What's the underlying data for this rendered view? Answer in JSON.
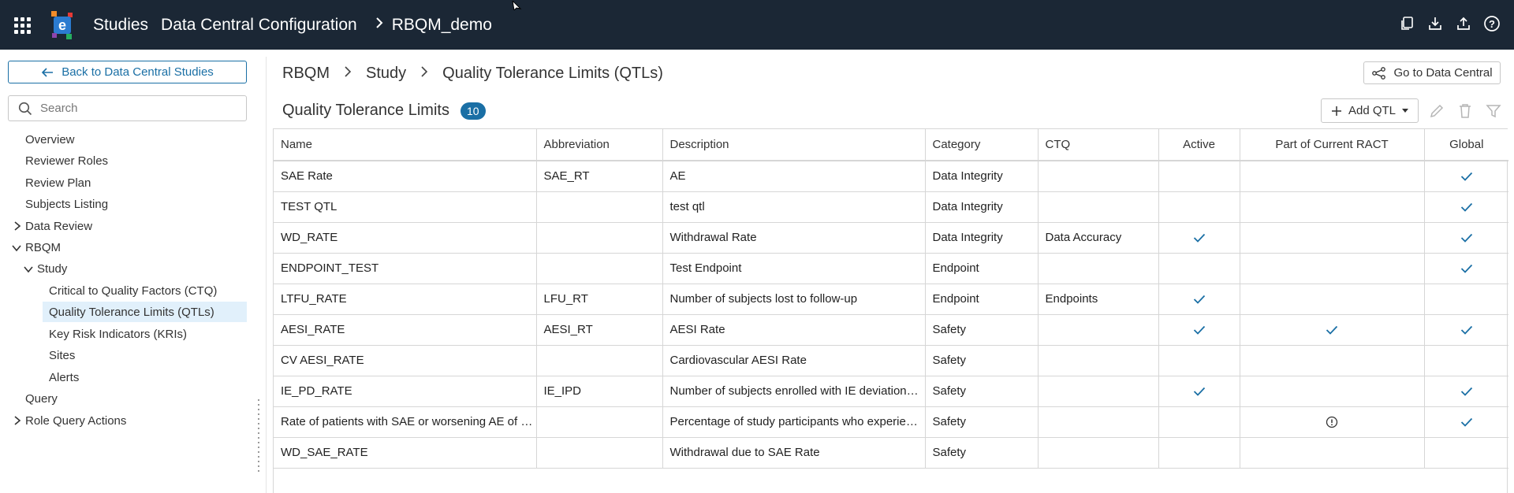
{
  "header": {
    "app_name": "Studies",
    "crumbs": [
      "Data Central Configuration",
      "RBQM_demo"
    ],
    "icons": [
      "copy-icon",
      "download-icon",
      "upload-icon",
      "help-icon"
    ]
  },
  "sidebar": {
    "back_label": "Back to Data Central Studies",
    "search_placeholder": "Search",
    "items": [
      {
        "label": "Overview"
      },
      {
        "label": "Reviewer Roles"
      },
      {
        "label": "Review Plan"
      },
      {
        "label": "Subjects Listing"
      },
      {
        "label": "Data Review"
      },
      {
        "label": "RBQM"
      },
      {
        "label": "Study"
      },
      {
        "label": "Critical to Quality Factors (CTQ)"
      },
      {
        "label": "Quality Tolerance Limits (QTLs)"
      },
      {
        "label": "Key Risk Indicators (KRIs)"
      },
      {
        "label": "Sites"
      },
      {
        "label": "Alerts"
      },
      {
        "label": "Query"
      },
      {
        "label": "Role Query Actions"
      }
    ]
  },
  "main": {
    "breadcrumb": [
      "RBQM",
      "Study",
      "Quality Tolerance Limits (QTLs)"
    ],
    "goto_label": "Go to Data Central",
    "title": "Quality Tolerance Limits",
    "count": "10",
    "add_label": "Add QTL",
    "accent_color": "#1a6fa5"
  },
  "table": {
    "columns": [
      "Name",
      "Abbreviation",
      "Description",
      "Category",
      "CTQ",
      "Active",
      "Part of Current RACT",
      "Global"
    ],
    "rows": [
      {
        "name": "SAE Rate",
        "abbr": "SAE_RT",
        "desc": "AE",
        "category": "Data Integrity",
        "ctq": "",
        "active": false,
        "ract": "",
        "global": true
      },
      {
        "name": "TEST QTL",
        "abbr": "",
        "desc": "test qtl",
        "category": "Data Integrity",
        "ctq": "",
        "active": false,
        "ract": "",
        "global": true
      },
      {
        "name": "WD_RATE",
        "abbr": "",
        "desc": "Withdrawal Rate",
        "category": "Data Integrity",
        "ctq": "Data Accuracy",
        "active": true,
        "ract": "",
        "global": true
      },
      {
        "name": "ENDPOINT_TEST",
        "abbr": "",
        "desc": "Test Endpoint",
        "category": "Endpoint",
        "ctq": "",
        "active": false,
        "ract": "",
        "global": true
      },
      {
        "name": "LTFU_RATE",
        "abbr": "LFU_RT",
        "desc": "Number of subjects lost to follow-up",
        "category": "Endpoint",
        "ctq": "Endpoints",
        "active": true,
        "ract": "",
        "global": false
      },
      {
        "name": "AESI_RATE",
        "abbr": "AESI_RT",
        "desc": "AESI Rate",
        "category": "Safety",
        "ctq": "",
        "active": true,
        "ract": "check",
        "global": true
      },
      {
        "name": "CV AESI_RATE",
        "abbr": "",
        "desc": "Cardiovascular AESI Rate",
        "category": "Safety",
        "ctq": "",
        "active": false,
        "ract": "",
        "global": false
      },
      {
        "name": "IE_PD_RATE",
        "abbr": "IE_IPD",
        "desc": "Number of subjects enrolled with IE deviation…",
        "category": "Safety",
        "ctq": "",
        "active": true,
        "ract": "",
        "global": true
      },
      {
        "name": "Rate of patients with SAE or worsening AE of …",
        "abbr": "",
        "desc": "Percentage of study participants who experie…",
        "category": "Safety",
        "ctq": "",
        "active": false,
        "ract": "info",
        "global": true
      },
      {
        "name": "WD_SAE_RATE",
        "abbr": "",
        "desc": "Withdrawal due to SAE Rate",
        "category": "Safety",
        "ctq": "",
        "active": false,
        "ract": "",
        "global": false
      }
    ]
  }
}
